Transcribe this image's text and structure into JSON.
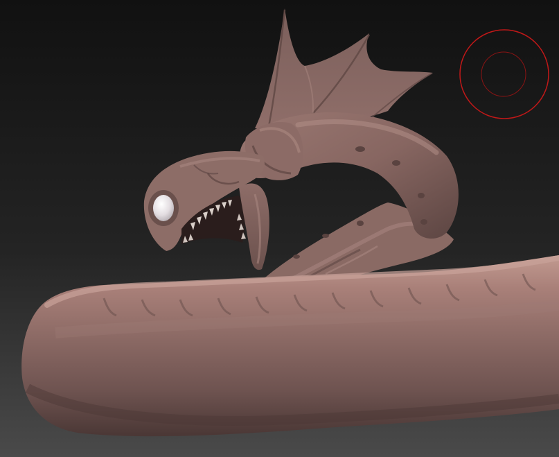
{
  "viewport": {
    "background_top": "#121212",
    "background_bottom": "#4a4a4a",
    "clay_color": "#8e6f6a",
    "clay_light": "#b48c85",
    "clay_dark": "#4e3a37",
    "eye_color": "#e6e1e4",
    "brush_cursor_color": "#c81a1a",
    "model": "sea-serpent-sculpt"
  }
}
